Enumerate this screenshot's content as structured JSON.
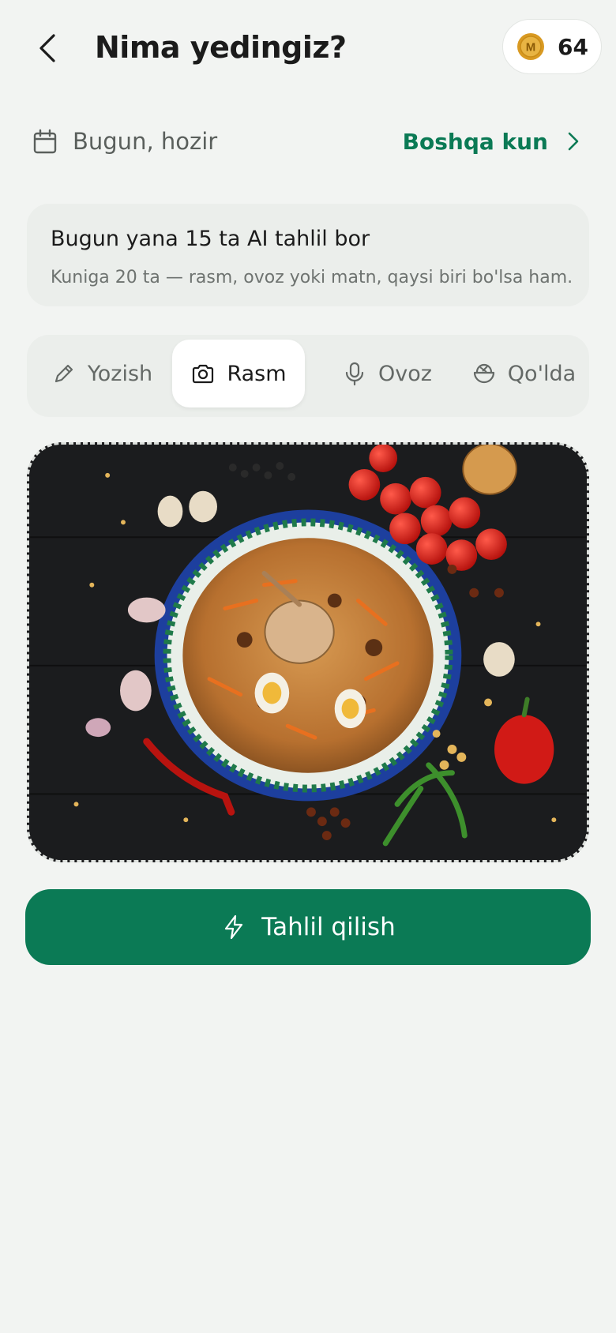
{
  "header": {
    "title": "Nima yedingiz?",
    "coins": "64",
    "coin_letter": "M",
    "coin_color": "#e3a62f"
  },
  "date": {
    "label": "Bugun, hozir",
    "other_day_label": "Boshqa kun"
  },
  "quota": {
    "title": "Bugun yana 15 ta AI tahlil bor",
    "subtitle": "Kuniga 20 ta — rasm, ovoz yoki matn, qaysi biri bo'lsa ham."
  },
  "tabs": [
    {
      "label": "Yozish",
      "icon": "pencil-icon",
      "active": false
    },
    {
      "label": "Rasm",
      "icon": "camera-icon",
      "active": true
    },
    {
      "label": "Ovoz",
      "icon": "microphone-icon",
      "active": false
    },
    {
      "label": "Qo'lda",
      "icon": "bowl-icon",
      "active": false
    }
  ],
  "action": {
    "label": "Tahlil qilish",
    "icon": "bolt-icon"
  },
  "colors": {
    "accent": "#0b7a55",
    "background": "#f2f4f2",
    "card": "#ebeeeb"
  }
}
